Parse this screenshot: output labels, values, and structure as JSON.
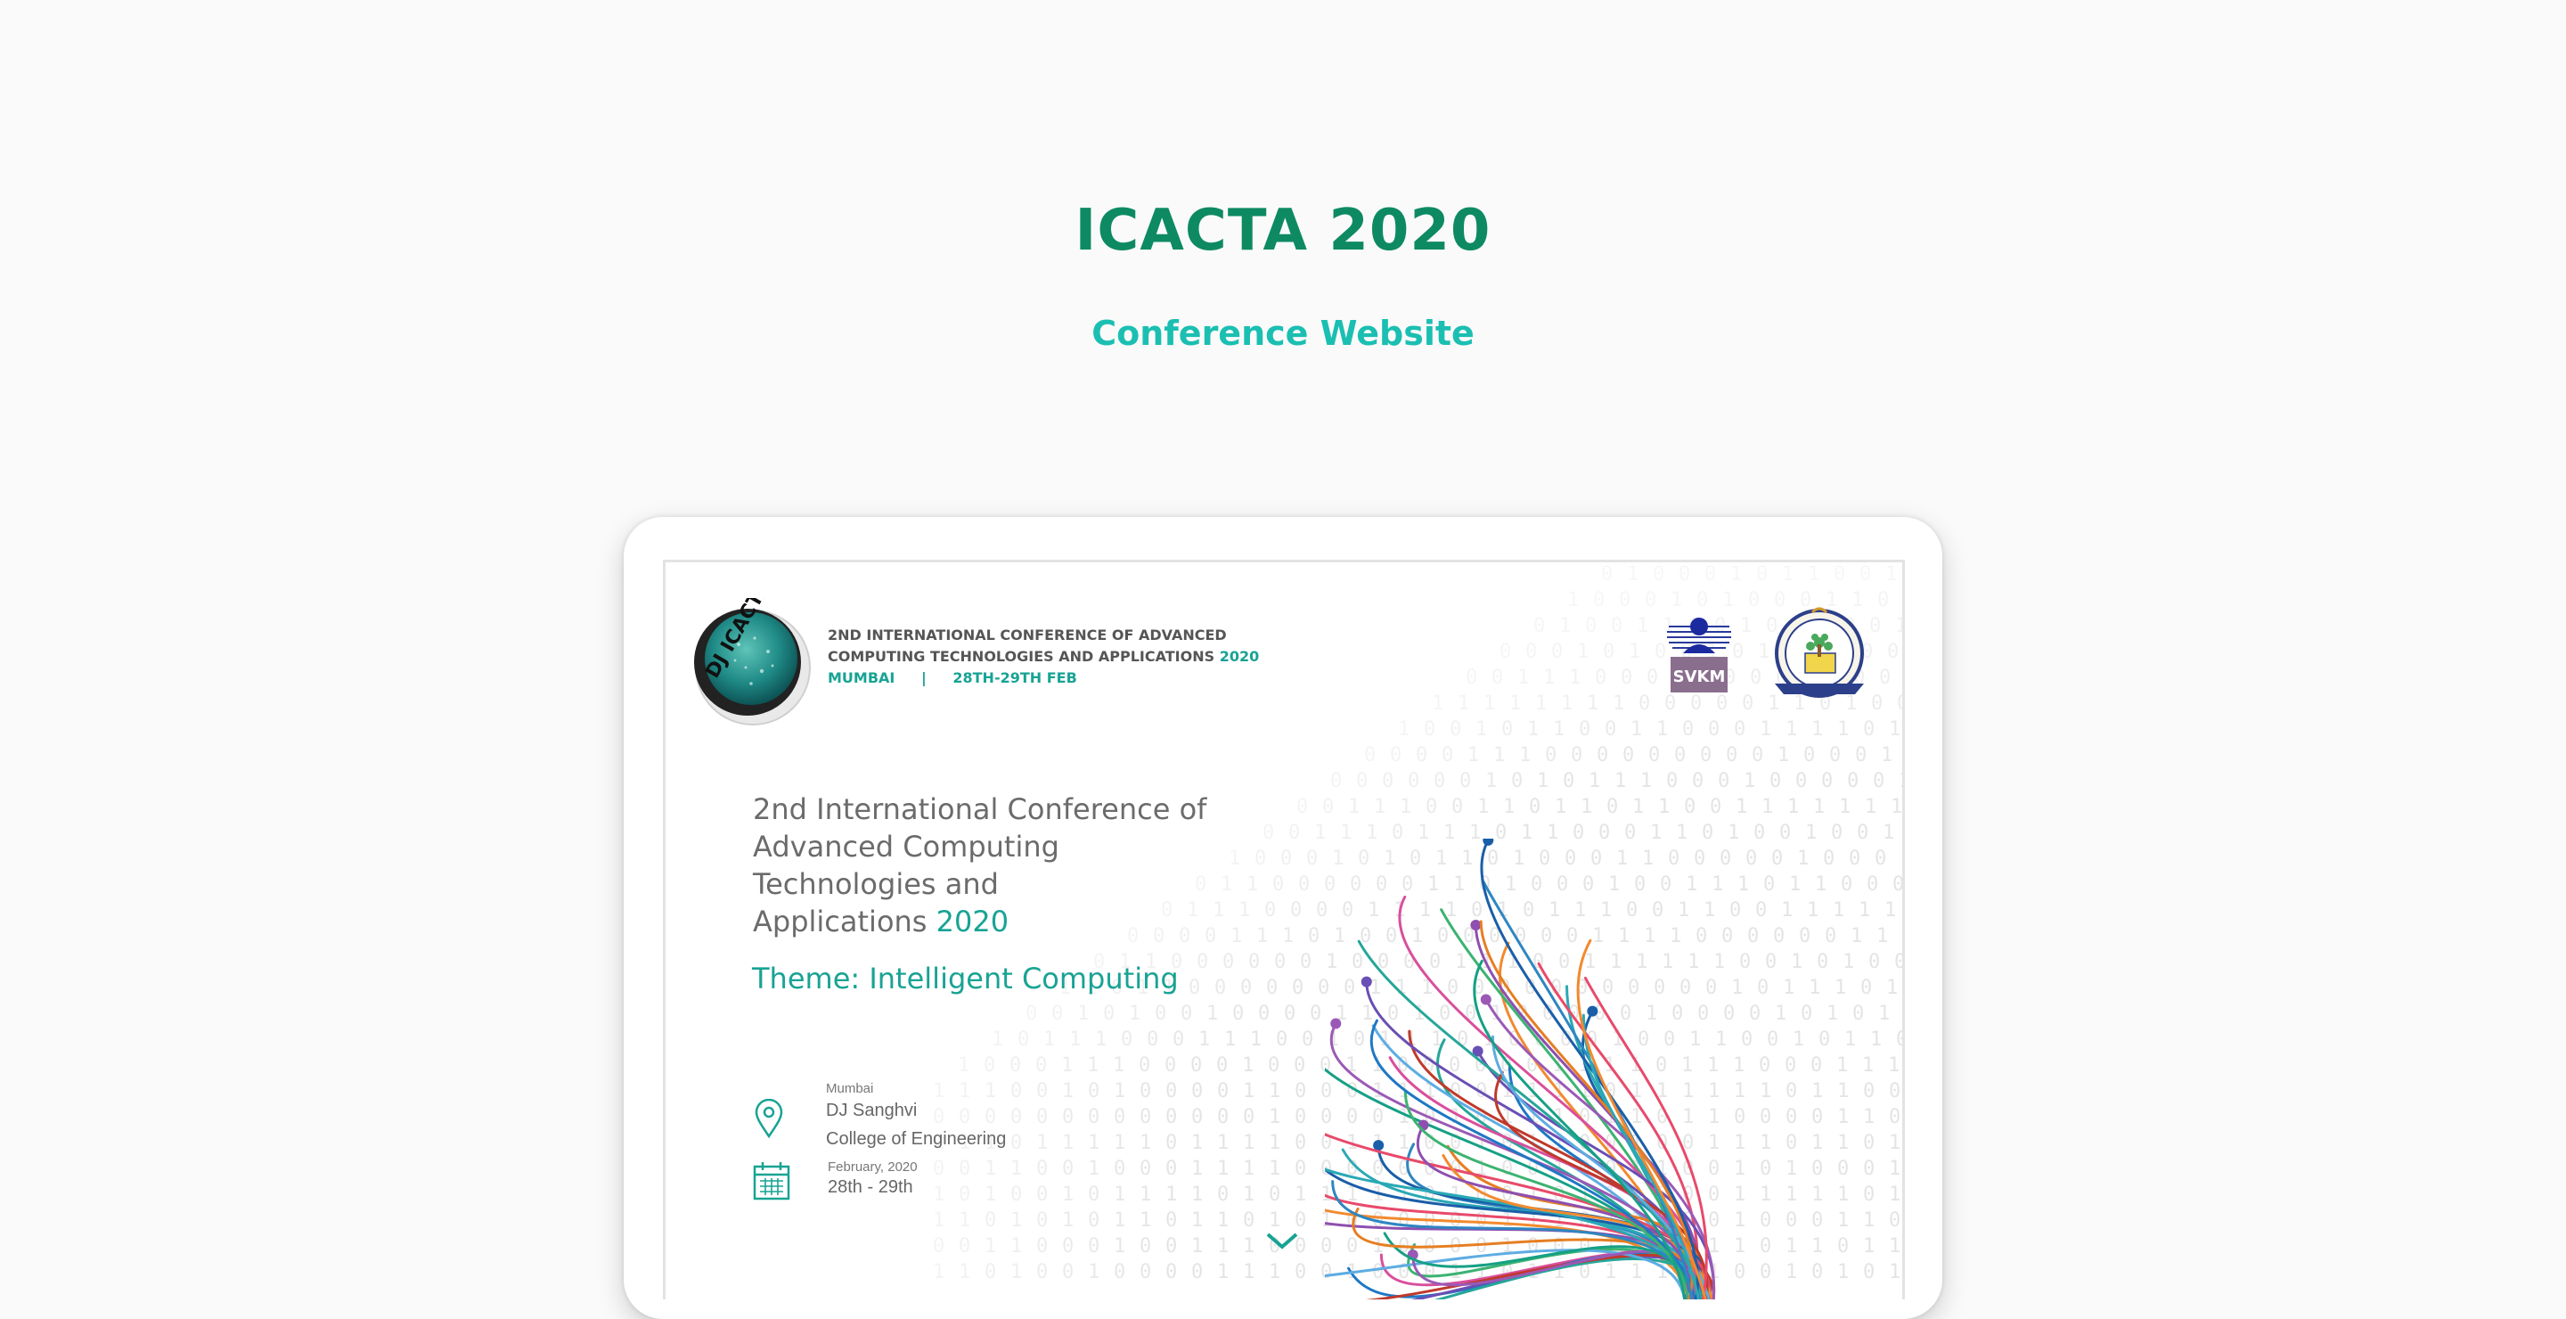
{
  "hero": {
    "title": "ICACTA 2020",
    "subtitle": "Conference Website"
  },
  "site": {
    "logo_left_text": "DJ ICACTA",
    "header": {
      "line1": "2ND INTERNATIONAL CONFERENCE OF ADVANCED",
      "line2": "COMPUTING TECHNOLOGIES AND APPLICATIONS",
      "line2_year": "2020",
      "city": "MUMBAI",
      "separator": "|",
      "dates": "28TH-29TH FEB"
    },
    "logo_svkm_text": "SVKM",
    "main_title": {
      "line1": "2nd International Conference of",
      "line2": "Advanced Computing",
      "line3": "Technologies and",
      "line4": "Applications",
      "year": "2020"
    },
    "theme": "Theme: Intelligent Computing",
    "venue": {
      "small": "Mumbai",
      "line1": "DJ Sanghvi",
      "line2": "College of Engineering",
      "icon": "location-pin-icon"
    },
    "date": {
      "small": "February, 2020",
      "range": "28th - 29th",
      "icon": "calendar-icon"
    },
    "scroll_icon": "chevron-down-icon"
  },
  "colors": {
    "brand_green": "#0e8a63",
    "accent_teal": "#18a394",
    "subtitle_teal": "#1bbfb2",
    "page_bg": "#fafafa"
  }
}
